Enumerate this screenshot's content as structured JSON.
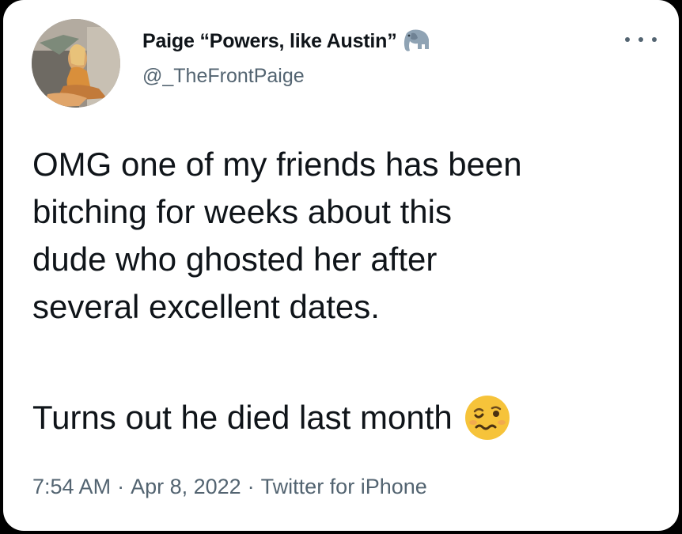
{
  "tweet": {
    "display_name": "Paige “Powers, like Austin”",
    "name_emoji_icon": "elephant-icon",
    "handle": "@_TheFrontPaige",
    "more_icon": "more-options-icon",
    "text_lines": [
      "OMG one of my friends has been",
      "bitching for weeks about this",
      "dude who ghosted her after",
      "several excellent dates."
    ],
    "last_line": "Turns out he died last month",
    "last_line_emoji_icon": "woozy-face-icon",
    "time": "7:54 AM",
    "date": "Apr 8, 2022",
    "source": "Twitter for iPhone",
    "separator": "·"
  },
  "colors": {
    "text_primary": "#0f1419",
    "text_secondary": "#536471",
    "background": "#ffffff"
  }
}
